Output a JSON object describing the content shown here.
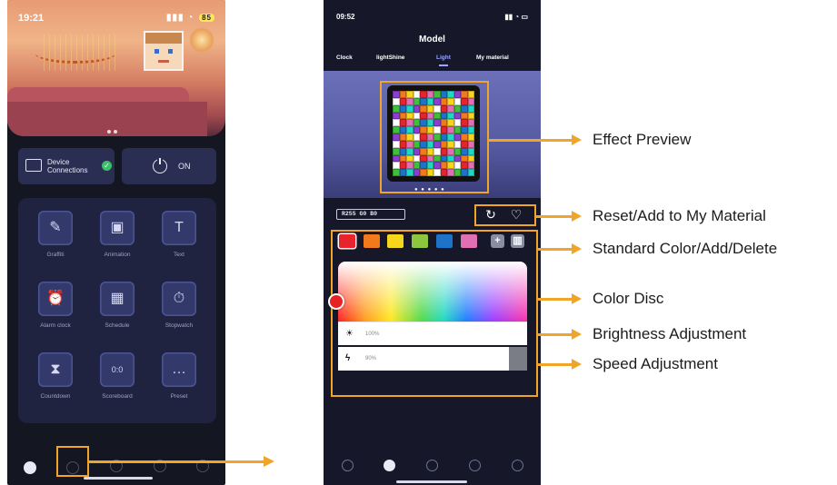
{
  "left_phone": {
    "status": {
      "time": "19:21",
      "battery": "85"
    },
    "device_card": {
      "label": "Device Connections",
      "check": "✓"
    },
    "power_card": {
      "label": "ON"
    },
    "tiles": [
      {
        "label": "Graffiti",
        "glyph": "✎"
      },
      {
        "label": "Animation",
        "glyph": "▣"
      },
      {
        "label": "Text",
        "glyph": "T"
      },
      {
        "label": "Alarm clock",
        "glyph": "⏰"
      },
      {
        "label": "Schedule",
        "glyph": "▦"
      },
      {
        "label": "Stopwatch",
        "glyph": "⏱"
      },
      {
        "label": "Countdown",
        "glyph": "⧗"
      },
      {
        "label": "Scoreboard",
        "glyph": "0:0"
      },
      {
        "label": "Preset",
        "glyph": "…"
      }
    ]
  },
  "right_phone": {
    "status": {
      "time": "09:52"
    },
    "title": "Model",
    "tabs": [
      "Clock",
      "lightShine",
      "Light",
      "My material"
    ],
    "active_tab": "Light",
    "rgb_readout": "R255  G0  B0",
    "swatches": [
      "#e8232b",
      "#f27a1d",
      "#f7d51c",
      "#8dc63f",
      "#1e73c8",
      "#e26fb4"
    ],
    "brightness_value": "100%",
    "speed_value": "90%"
  },
  "callouts": {
    "effect_preview": "Effect Preview",
    "reset_add": "Reset/Add to My Material",
    "standard_color": "Standard Color/Add/Delete",
    "color_disc": "Color Disc",
    "brightness": "Brightness Adjustment",
    "speed": "Speed Adjustment"
  },
  "colors": {
    "accent": "#f0a528",
    "phone_bg": "#16182a",
    "panel": "#1f2340"
  }
}
